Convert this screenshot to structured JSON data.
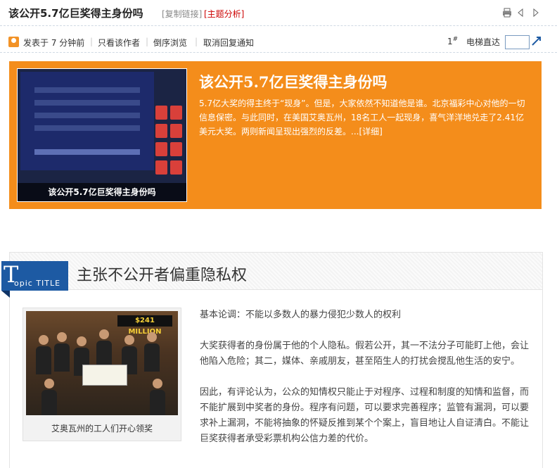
{
  "header": {
    "title": "该公开5.7亿巨奖得主身份吗",
    "copy_link": "[复制链接]",
    "topic_analysis": "[主题分析]"
  },
  "meta": {
    "posted": "发表于 7 分钟前",
    "only_author": "只看该作者",
    "reverse": "倒序浏览",
    "cancel_notify": "取消回复通知",
    "floor": "1",
    "floor_mark": "#",
    "elevator": "电梯直达"
  },
  "promo": {
    "title": "该公开5.7亿巨奖得主身份吗",
    "text": "5.7亿大奖的得主终于“现身”。但是，大家依然不知道他是谁。北京福彩中心对他的一切信息保密。与此同时，在美国艾奥瓦州，18名工人一起现身，喜气洋洋地兑走了2.41亿美元大奖。两则新闻呈现出强烈的反差。",
    "more": "...[详细]",
    "image_caption": "该公开5.7亿巨奖得主身份吗"
  },
  "topic": {
    "badge_big": "T",
    "badge_small": "opic TITLE",
    "heading": "主张不公开者偏重隐私权",
    "photo_caption": "艾奥瓦州的工人们开心领奖",
    "photo_banner": "$241 MILLION",
    "paragraphs": [
      "基本论调：不能以多数人的暴力侵犯少数人的权利",
      "大奖获得者的身份属于他的个人隐私。假若公开，其一不法分子可能盯上他，会让他陷入危险；其二，媒体、亲戚朋友，甚至陌生人的打扰会搅乱他生活的安宁。",
      "因此，有评论认为，公众的知情权只能止于对程序、过程和制度的知情和监督，而不能扩展到中奖者的身份。程序有问题，可以要求完善程序；监管有漏洞，可以要求补上漏洞，不能将抽象的怀疑反推到某个个案上，盲目地让人自证清白。不能让巨奖获得者承受彩票机构公信力差的代价。"
    ]
  },
  "colors": {
    "promo_bg": "#f48d1b",
    "badge_bg": "#1d5aa3",
    "topic_link": "#cc0000"
  }
}
